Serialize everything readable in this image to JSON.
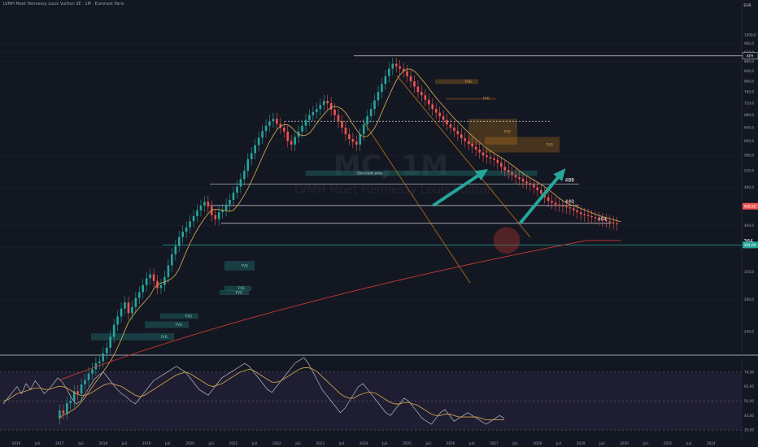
{
  "header": {
    "title": "LVMH Moet Hennessy Louis Vuitton SE · 1M · Euronext Paris",
    "currency": "EUR",
    "watermark_symbol": "MC, 1M",
    "watermark_name": "LVMH Moet Hennessy Louis Vuitton"
  },
  "colors": {
    "background": "#131722",
    "up": "#26a69a",
    "down": "#ef5350",
    "ma_fast": "#c8a24a",
    "ma_slow": "#c6392f",
    "orange_zone": "#b8741a",
    "arrow": "#26a69a",
    "rsi_line": "#b6bac4",
    "rsi_ma": "#c8a24a",
    "rsi_band": "#2a2240"
  },
  "chart_data": [
    {
      "type": "candlestick",
      "series": [
        {
          "name": "price",
          "x_start": "2017-01",
          "interval": "1M",
          "values": [
            158,
            164,
            162,
            170,
            172,
            180,
            178,
            186,
            190,
            196,
            200,
            206,
            208,
            216,
            222,
            234,
            248,
            258,
            268,
            276,
            262,
            270,
            282,
            290,
            300,
            310,
            316,
            306,
            296,
            300,
            312,
            330,
            348,
            362,
            378,
            388,
            396,
            408,
            418,
            430,
            440,
            448,
            438,
            420,
            412,
            426,
            430,
            442,
            452,
            468,
            482,
            500,
            520,
            550,
            566,
            588,
            610,
            630,
            646,
            660,
            668,
            652,
            640,
            628,
            600,
            590,
            612,
            628,
            646,
            664,
            680,
            690,
            700,
            714,
            728,
            720,
            698,
            680,
            660,
            640,
            620,
            606,
            598,
            590,
            620,
            650,
            676,
            700,
            730,
            760,
            790,
            820,
            850,
            870,
            860,
            850,
            840,
            820,
            800,
            780,
            760,
            748,
            732,
            716,
            700,
            688,
            676,
            664,
            650,
            640,
            630,
            620,
            608,
            600,
            592,
            584,
            576,
            568,
            560,
            556,
            552,
            548,
            540,
            530,
            522,
            516,
            510,
            504,
            500,
            494,
            490,
            486,
            480,
            474,
            466,
            458,
            450,
            446,
            442,
            440,
            438,
            436,
            434,
            430,
            426,
            422,
            420,
            418,
            416,
            414,
            412,
            410,
            408,
            406,
            404,
            402
          ]
        },
        {
          "name": "projection",
          "points": [
            [
              2025.6,
              440
            ],
            [
              2026.8,
              520
            ],
            [
              2027.6,
              404
            ],
            [
              2028.6,
              520
            ]
          ]
        }
      ],
      "y_axis": {
        "scale": "log",
        "ticks": [
          "1000,0",
          "960,0",
          "920,0",
          "880,0",
          "840,0",
          "800,0",
          "760,0",
          "720,0",
          "680,0",
          "640,0",
          "600,0",
          "560,0",
          "520,0",
          "480,0",
          "440,0",
          "400,0",
          "360,0",
          "320,0",
          "280,0",
          "240,0"
        ]
      },
      "x_axis": {
        "ticks": [
          "2016",
          "Juil.",
          "2017",
          "Juil.",
          "2018",
          "Juil.",
          "2019",
          "Juil.",
          "2020",
          "Juil.",
          "2021",
          "Juil.",
          "2022",
          "Juil.",
          "2023",
          "Juil.",
          "2024",
          "Juil.",
          "2025",
          "Juil.",
          "2026",
          "Juil.",
          "2027",
          "Juil.",
          "2028",
          "Juil.",
          "2029",
          "Juil.",
          "2030",
          "Juil.",
          "2031",
          "Juil.",
          "2024"
        ]
      },
      "price_badges": [
        {
          "label": "438,50",
          "value": 438.5,
          "color": "#ef5350"
        },
        {
          "label": "364,00",
          "value": 364,
          "color": "#26a69a"
        },
        {
          "label": "ATH",
          "value": 904,
          "color": "#ffffff"
        }
      ],
      "levels": [
        {
          "value": 904,
          "label": "ATH"
        },
        {
          "value": 660,
          "label": ""
        },
        {
          "value": 488,
          "label": "488"
        },
        {
          "value": 440,
          "label": "440"
        },
        {
          "value": 404,
          "label": "404"
        },
        {
          "value": 364,
          "label": "364"
        }
      ],
      "zones": [
        {
          "label": "FVG",
          "kind": "orange",
          "high": 808,
          "low": 790
        },
        {
          "label": "FVG",
          "kind": "orange",
          "high": 738,
          "low": 736
        },
        {
          "label": "FVG",
          "kind": "orange",
          "high": 668,
          "low": 590
        },
        {
          "label": "FVG",
          "kind": "orange",
          "high": 612,
          "low": 568
        },
        {
          "label": "",
          "kind": "teal",
          "high": 520,
          "low": 508
        },
        {
          "label": "FVG",
          "kind": "green",
          "high": 337,
          "low": 322
        },
        {
          "label": "FVG",
          "kind": "green",
          "high": 299,
          "low": 292
        },
        {
          "label": "FVG",
          "kind": "green",
          "high": 293,
          "low": 286
        },
        {
          "label": "FVG",
          "kind": "green",
          "high": 262,
          "low": 255
        },
        {
          "label": "FVG",
          "kind": "green",
          "high": 252,
          "low": 244
        },
        {
          "label": "FVG",
          "kind": "green",
          "high": 238,
          "low": 230
        }
      ],
      "annotations": [
        "Discount area"
      ]
    },
    {
      "type": "line",
      "series": [
        {
          "name": "RSI",
          "values": [
            48,
            52,
            56,
            60,
            55,
            62,
            58,
            64,
            60,
            55,
            58,
            62,
            66,
            63,
            58,
            52,
            48,
            50,
            55,
            60,
            65,
            68,
            70,
            66,
            62,
            58,
            55,
            53,
            50,
            48,
            52,
            56,
            60,
            64,
            66,
            68,
            70,
            72,
            74,
            72,
            70,
            66,
            62,
            58,
            56,
            54,
            58,
            62,
            66,
            68,
            70,
            72,
            74,
            76,
            74,
            70,
            66,
            62,
            58,
            56,
            60,
            64,
            68,
            72,
            76,
            78,
            80,
            76,
            70,
            64,
            58,
            54,
            50,
            46,
            42,
            45,
            50,
            55,
            60,
            62,
            58,
            54,
            50,
            46,
            42,
            40,
            44,
            48,
            52,
            50,
            46,
            42,
            38,
            36,
            34,
            38,
            42,
            44,
            40,
            36,
            38,
            40,
            42,
            40,
            38,
            36,
            34,
            36,
            38,
            40,
            38
          ]
        },
        {
          "name": "RSI MA",
          "values": [
            50,
            51,
            53,
            55,
            56,
            57,
            58,
            59,
            59,
            58,
            58,
            59,
            60,
            60,
            59,
            57,
            55,
            54,
            54,
            55,
            57,
            59,
            61,
            62,
            62,
            61,
            60,
            58,
            56,
            54,
            53,
            54,
            56,
            58,
            60,
            62,
            64,
            66,
            68,
            69,
            70,
            69,
            67,
            65,
            63,
            61,
            60,
            61,
            62,
            64,
            66,
            68,
            70,
            71,
            72,
            71,
            69,
            67,
            65,
            63,
            63,
            64,
            66,
            68,
            70,
            72,
            73,
            73,
            72,
            70,
            67,
            64,
            61,
            58,
            55,
            53,
            52,
            52,
            54,
            55,
            56,
            56,
            55,
            53,
            51,
            49,
            48,
            48,
            49,
            49,
            48,
            47,
            45,
            43,
            41,
            40,
            40,
            41,
            41,
            40,
            39,
            39,
            39,
            39,
            39,
            38,
            37,
            37,
            37,
            37,
            37
          ]
        }
      ],
      "y_axis": {
        "ticks": [
          "70,00",
          "60,00",
          "50,00",
          "40,00",
          "30,00"
        ]
      }
    }
  ]
}
